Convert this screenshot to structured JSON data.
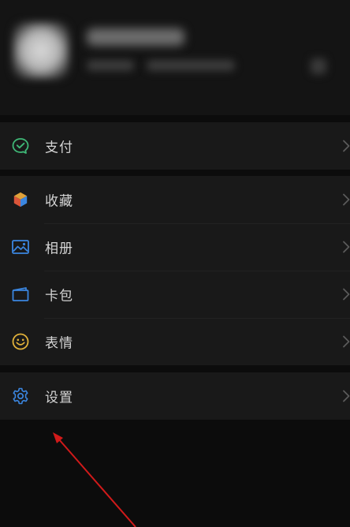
{
  "menu": {
    "pay": {
      "label": "支付",
      "icon": "wechat-pay-icon",
      "color": "#3fb877"
    },
    "favorites": {
      "label": "收藏",
      "icon": "favorites-cube-icon",
      "color": "#e0a23a"
    },
    "album": {
      "label": "相册",
      "icon": "album-image-icon",
      "color": "#3b86e0"
    },
    "cards": {
      "label": "卡包",
      "icon": "card-wallet-icon",
      "color": "#3b86e0"
    },
    "stickers": {
      "label": "表情",
      "icon": "smiley-icon",
      "color": "#e2b23a"
    },
    "settings": {
      "label": "设置",
      "icon": "gear-icon",
      "color": "#3b86e0"
    }
  },
  "annotation": {
    "color": "#d11a1a",
    "icon": "red-arrow-pointer"
  },
  "colors": {
    "background": "#0c0c0c",
    "row": "#191919",
    "text": "#d4d4d4",
    "chevron": "#5a5a5a"
  }
}
